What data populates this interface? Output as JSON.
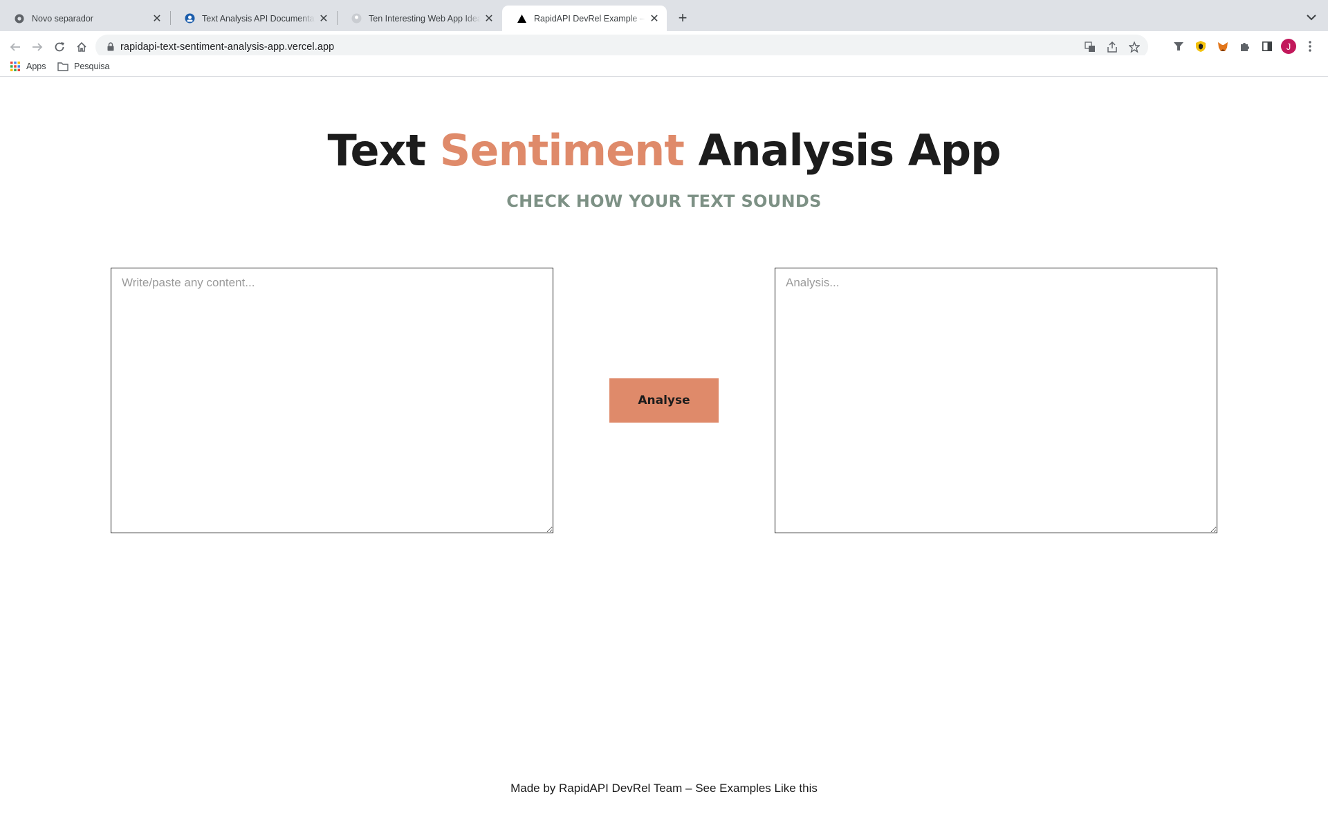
{
  "browser": {
    "tabs": [
      {
        "title": "Novo separador",
        "icon": "chrome-icon",
        "active": false
      },
      {
        "title": "Text Analysis API Documentation",
        "icon": "rapidapi-icon",
        "active": false
      },
      {
        "title": "Ten Interesting Web App Ideas",
        "icon": "avatar-icon",
        "active": false
      },
      {
        "title": "RapidAPI DevRel Example – Text Sentiment Analysis App",
        "icon": "vercel-triangle-icon",
        "active": true
      }
    ],
    "url": "rapidapi-text-sentiment-analysis-app.vercel.app",
    "profile_initial": "J",
    "bookmarks": [
      {
        "label": "Apps",
        "icon": "apps-grid-icon"
      },
      {
        "label": "Pesquisa",
        "icon": "folder-icon"
      }
    ]
  },
  "page": {
    "title_part1": "Text ",
    "title_accent": "Sentiment",
    "title_part2": " Analysis App",
    "subtitle": "CHECK HOW YOUR TEXT SOUNDS",
    "input_placeholder": "Write/paste any content...",
    "output_placeholder": "Analysis...",
    "analyse_label": "Analyse",
    "footer": "Made by RapidAPI DevRel Team – See Examples Like this"
  },
  "colors": {
    "accent": "#df8a6a",
    "subtitle": "#7d9185",
    "text": "#1c1c1c"
  }
}
